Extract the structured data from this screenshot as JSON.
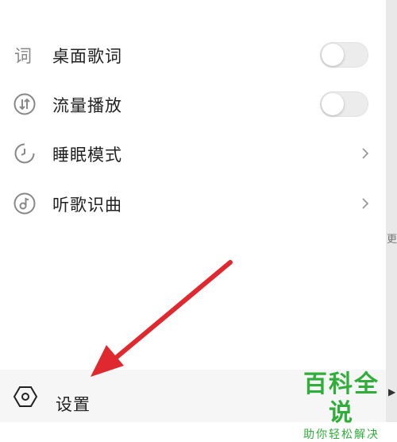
{
  "menu": {
    "items": [
      {
        "label": "桌面歌词",
        "icon": "lyrics-icon",
        "control": "toggle",
        "toggle_on": false
      },
      {
        "label": "流量播放",
        "icon": "data-play-icon",
        "control": "toggle",
        "toggle_on": false
      },
      {
        "label": "睡眠模式",
        "icon": "clock-icon",
        "control": "chevron"
      },
      {
        "label": "听歌识曲",
        "icon": "music-recognize-icon",
        "control": "chevron"
      }
    ],
    "lyrics_icon_glyph": "词"
  },
  "bottom_bar": {
    "settings_label": "设置",
    "icon": "hexagon-settings-icon"
  },
  "side_fragments": {
    "frag1": "更",
    "frag2": "▶"
  },
  "watermark": {
    "title": "百科全说",
    "subtitle": "助你轻松解决"
  },
  "colors": {
    "annotation_arrow": "#e0282f",
    "watermark_green": "#2fae3a",
    "toggle_off": "#ececec"
  }
}
